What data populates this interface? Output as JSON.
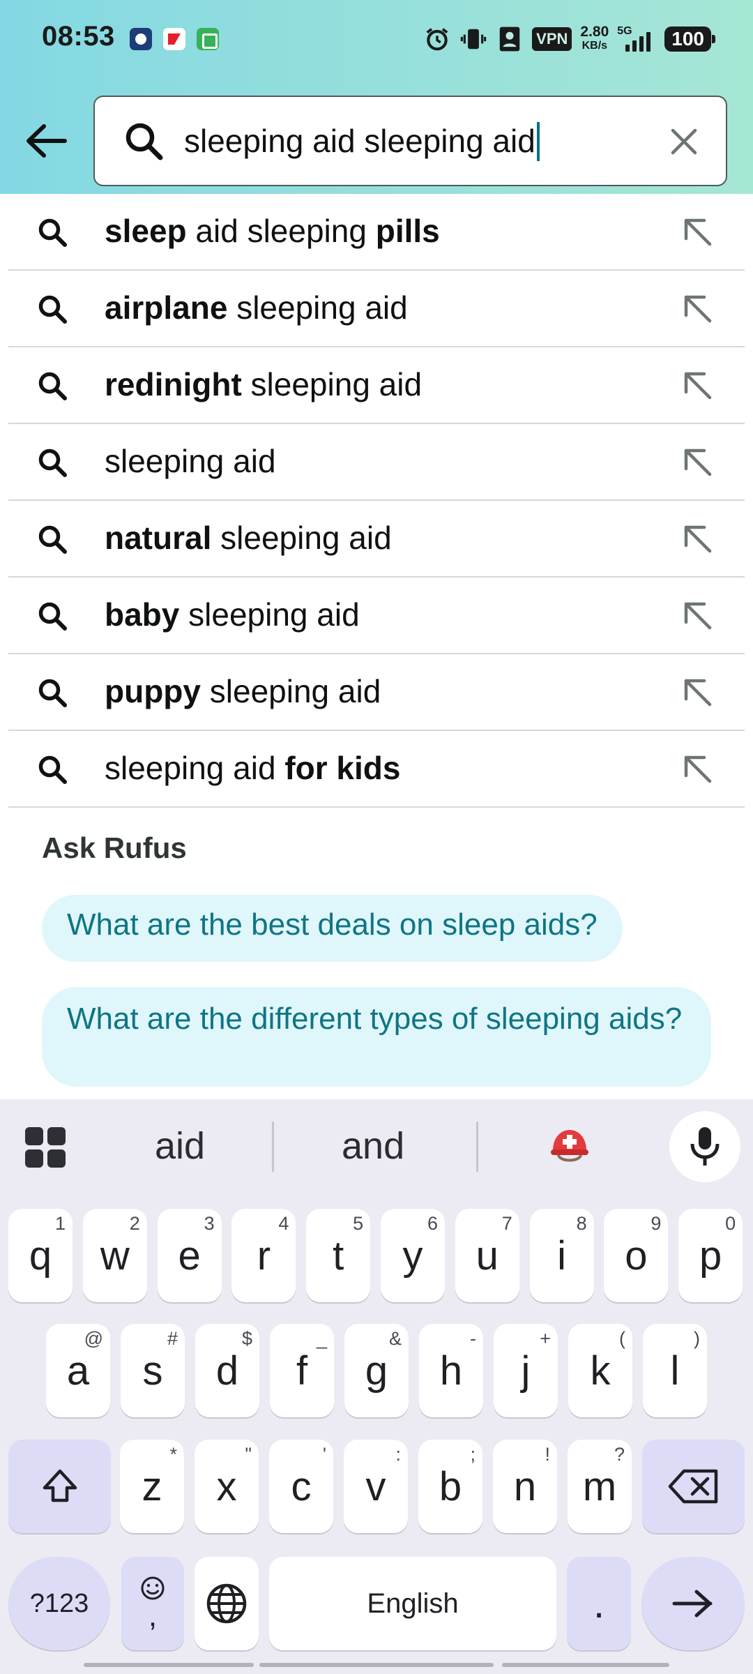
{
  "status_bar": {
    "time": "08:53",
    "vpn": "VPN",
    "net_speed_value": "2.80",
    "net_speed_unit": "KB/s",
    "network_type": "5G",
    "battery": "100",
    "signal_level": "4 of 4"
  },
  "search": {
    "query": "sleeping aid sleeping aid"
  },
  "suggestions": [
    {
      "parts": [
        {
          "t": "sleep",
          "b": true
        },
        {
          "t": " aid sleeping ",
          "b": false
        },
        {
          "t": "pills",
          "b": true
        }
      ]
    },
    {
      "parts": [
        {
          "t": "airplane",
          "b": true
        },
        {
          "t": " sleeping aid",
          "b": false
        }
      ]
    },
    {
      "parts": [
        {
          "t": "redinight",
          "b": true
        },
        {
          "t": " sleeping aid",
          "b": false
        }
      ]
    },
    {
      "parts": [
        {
          "t": "sleeping aid",
          "b": false
        }
      ]
    },
    {
      "parts": [
        {
          "t": "natural",
          "b": true
        },
        {
          "t": " sleeping aid",
          "b": false
        }
      ]
    },
    {
      "parts": [
        {
          "t": "baby",
          "b": true
        },
        {
          "t": " sleeping aid",
          "b": false
        }
      ]
    },
    {
      "parts": [
        {
          "t": "puppy",
          "b": true
        },
        {
          "t": " sleeping aid",
          "b": false
        }
      ]
    },
    {
      "parts": [
        {
          "t": "sleeping aid ",
          "b": false
        },
        {
          "t": "for kids",
          "b": true
        }
      ]
    }
  ],
  "rufus": {
    "title": "Ask Rufus",
    "questions": [
      "What are the best deals on sleep aids?",
      "What are the different types of sleeping aids?"
    ]
  },
  "keyboard": {
    "suggestions": [
      "aid",
      "and"
    ],
    "emoji_suggestion": "rescue-worker-helmet",
    "row1": [
      {
        "k": "q",
        "h": "1"
      },
      {
        "k": "w",
        "h": "2"
      },
      {
        "k": "e",
        "h": "3"
      },
      {
        "k": "r",
        "h": "4"
      },
      {
        "k": "t",
        "h": "5"
      },
      {
        "k": "y",
        "h": "6"
      },
      {
        "k": "u",
        "h": "7"
      },
      {
        "k": "i",
        "h": "8"
      },
      {
        "k": "o",
        "h": "9"
      },
      {
        "k": "p",
        "h": "0"
      }
    ],
    "row2": [
      {
        "k": "a",
        "h": "@"
      },
      {
        "k": "s",
        "h": "#"
      },
      {
        "k": "d",
        "h": "$"
      },
      {
        "k": "f",
        "h": "_"
      },
      {
        "k": "g",
        "h": "&"
      },
      {
        "k": "h",
        "h": "-"
      },
      {
        "k": "j",
        "h": "+"
      },
      {
        "k": "k",
        "h": "("
      },
      {
        "k": "l",
        "h": ")"
      }
    ],
    "row3": [
      {
        "k": "z",
        "h": "*"
      },
      {
        "k": "x",
        "h": "\""
      },
      {
        "k": "c",
        "h": "'"
      },
      {
        "k": "v",
        "h": ":"
      },
      {
        "k": "b",
        "h": ";"
      },
      {
        "k": "n",
        "h": "!"
      },
      {
        "k": "m",
        "h": "?"
      }
    ],
    "symbols_label": "?123",
    "comma": ",",
    "space_label": "English",
    "period": "."
  },
  "colors": {
    "header_gradient_start": "#84d8e3",
    "header_gradient_end": "#a6e6d5",
    "rufus_chip_bg": "#dff7fb",
    "rufus_chip_text": "#0f7584",
    "caret": "#007185",
    "keyboard_bg": "#eceaf3",
    "keyboard_accent": "#dcdcf7"
  }
}
